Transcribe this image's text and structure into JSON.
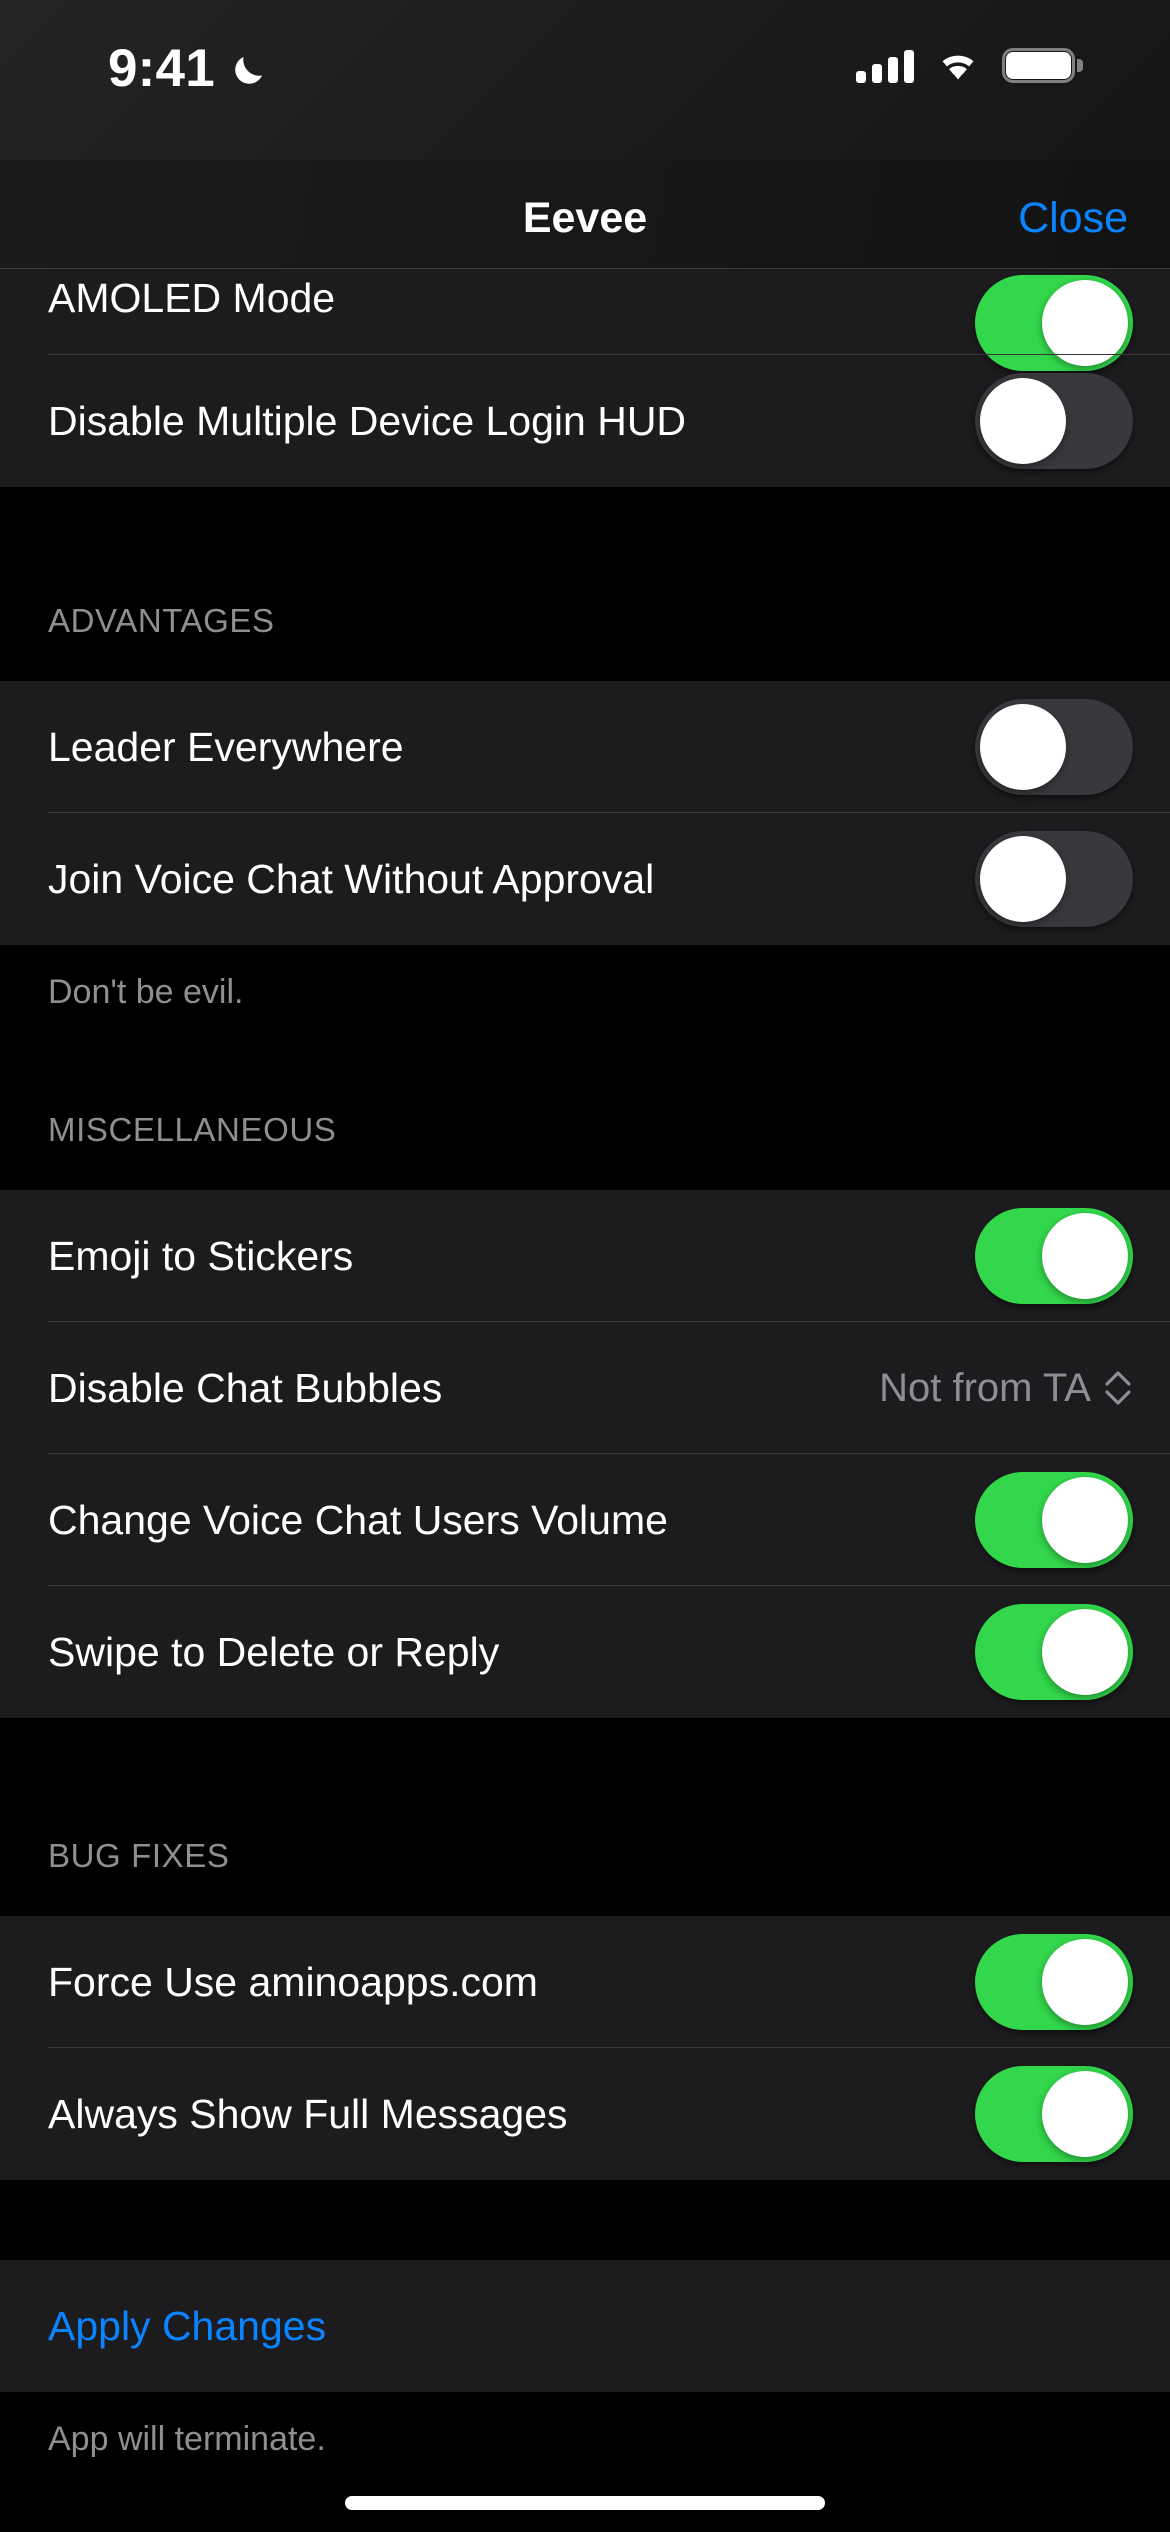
{
  "status_bar": {
    "time": "9:41",
    "dnd_icon": "moon-icon",
    "cellular_icon": "cellular-signal-icon",
    "wifi_icon": "wifi-icon",
    "battery_icon": "battery-full-icon"
  },
  "nav": {
    "title": "Eevee",
    "close_label": "Close",
    "accent_color": "#0a84ff"
  },
  "colors": {
    "toggle_on": "#32d74b",
    "toggle_off": "#39393d",
    "group_background": "#1c1c1e",
    "page_background": "#000000",
    "separator": "#38383a",
    "secondary_text": "#8e8e93",
    "accent": "#0a84ff"
  },
  "sections": [
    {
      "id": "top-partial",
      "header": null,
      "footer": null,
      "rows": [
        {
          "label": "AMOLED Mode",
          "type": "toggle",
          "value": "on",
          "clipped": true
        },
        {
          "label": "Disable Multiple Device Login HUD",
          "type": "toggle",
          "value": "off"
        }
      ]
    },
    {
      "id": "advantages",
      "header": "ADVANTAGES",
      "footer": "Don't be evil.",
      "rows": [
        {
          "label": "Leader Everywhere",
          "type": "toggle",
          "value": "off"
        },
        {
          "label": "Join Voice Chat Without Approval",
          "type": "toggle",
          "value": "off"
        }
      ]
    },
    {
      "id": "miscellaneous",
      "header": "MISCELLANEOUS",
      "footer": null,
      "rows": [
        {
          "label": "Emoji to Stickers",
          "type": "toggle",
          "value": "on"
        },
        {
          "label": "Disable Chat Bubbles",
          "type": "menu",
          "value": "Not from TA",
          "icon": "up-down-chevron-icon"
        },
        {
          "label": "Change Voice Chat Users Volume",
          "type": "toggle",
          "value": "on"
        },
        {
          "label": "Swipe to Delete or Reply",
          "type": "toggle",
          "value": "on"
        }
      ]
    },
    {
      "id": "bug-fixes",
      "header": "BUG FIXES",
      "footer": null,
      "rows": [
        {
          "label": "Force Use aminoapps.com",
          "type": "toggle",
          "value": "on"
        },
        {
          "label": "Always Show Full Messages",
          "type": "toggle",
          "value": "on"
        }
      ]
    },
    {
      "id": "apply",
      "header": null,
      "footer": "App will terminate.",
      "rows": [
        {
          "label": "Apply Changes",
          "type": "action"
        }
      ]
    }
  ]
}
